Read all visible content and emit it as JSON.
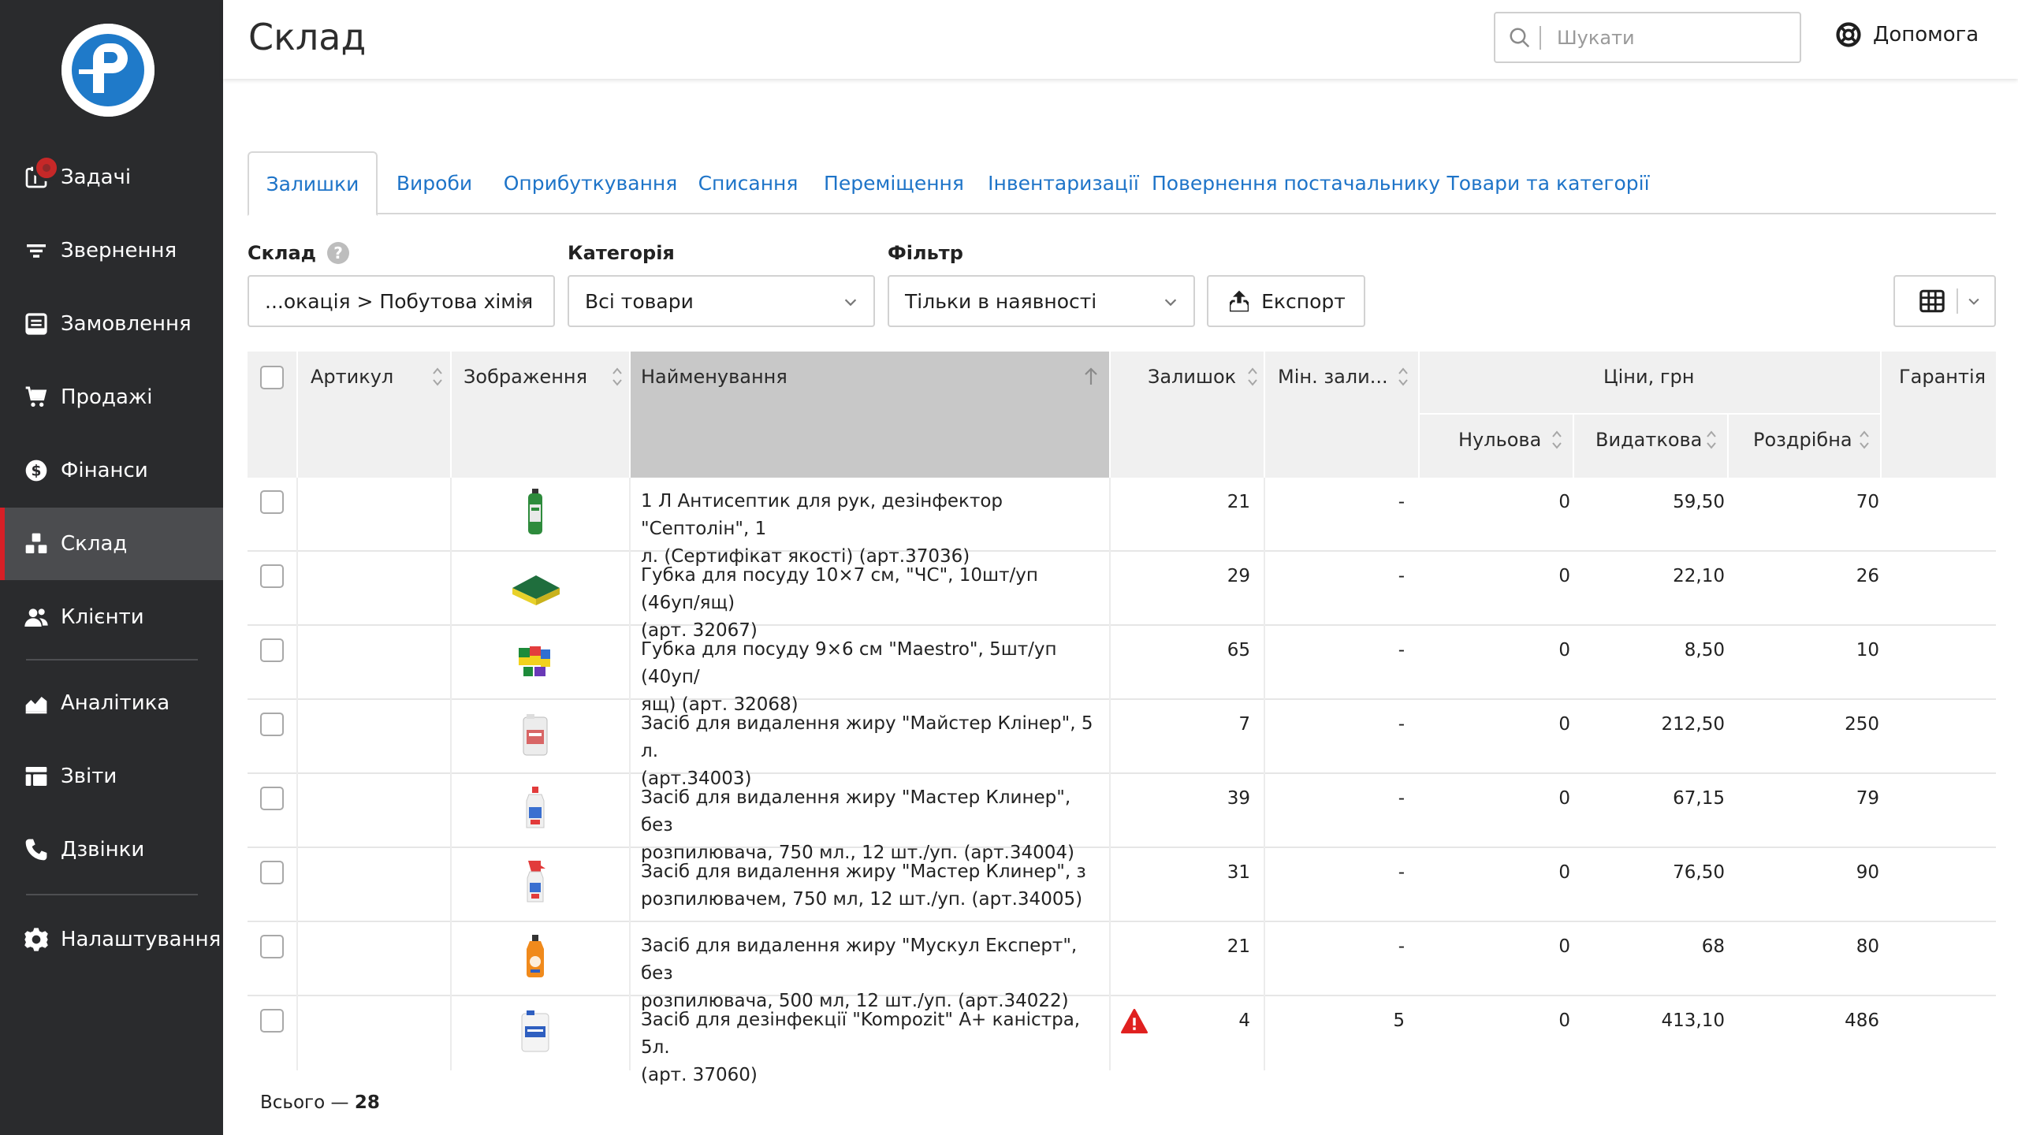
{
  "sidebar": {
    "logo_icon": "company-logo",
    "items": [
      {
        "label": "Задачі",
        "icon": "tasks-icon"
      },
      {
        "label": "Звернення",
        "icon": "filter-icon"
      },
      {
        "label": "Замовлення",
        "icon": "orders-icon"
      },
      {
        "label": "Продажі",
        "icon": "cart-icon"
      },
      {
        "label": "Фінанси",
        "icon": "dollar-icon"
      },
      {
        "label": "Склад",
        "icon": "warehouse-icon",
        "active": true
      },
      {
        "label": "Клієнти",
        "icon": "clients-icon"
      },
      {
        "label": "Аналітика",
        "icon": "analytics-icon"
      },
      {
        "label": "Звіти",
        "icon": "reports-icon"
      },
      {
        "label": "Дзвінки",
        "icon": "phone-icon"
      },
      {
        "label": "Налаштування",
        "icon": "gear-icon"
      }
    ],
    "accent_color": "#d71f26",
    "badge_color": "#c62828"
  },
  "header": {
    "title": "Склад",
    "search_placeholder": "Шукати",
    "help_label": "Допомога"
  },
  "tabs": [
    {
      "label": "Залишки",
      "active": true
    },
    {
      "label": "Вироби"
    },
    {
      "label": "Оприбуткування"
    },
    {
      "label": "Списання"
    },
    {
      "label": "Переміщення"
    },
    {
      "label": "Інвентаризації"
    },
    {
      "label": "Повернення постачальнику"
    },
    {
      "label": "Товари та категорії"
    }
  ],
  "filters": {
    "warehouse_label": "Склад",
    "warehouse_value": "...окація > Побутова хімія",
    "category_label": "Категорія",
    "category_value": "Всі товари",
    "filter_label": "Фільтр",
    "filter_value": "Тільки в наявності",
    "export_label": "Експорт"
  },
  "table": {
    "headers": {
      "article": "Артикул",
      "image": "Зображення",
      "name": "Найменування",
      "stock": "Залишок",
      "min_stock": "Мін. зали...",
      "prices_group": "Ціни, грн",
      "price_zero": "Нульова",
      "price_out": "Видаткова",
      "price_retail": "Роздрібна",
      "warranty": "Гарантія"
    },
    "rows": [
      {
        "name_line1": "1 Л Антисептик для рук, дезінфектор \"Септолін\", 1",
        "name_line2": "л. (Сертифікат якості) (арт.37036)",
        "stock": "21",
        "min": "-",
        "zero": "0",
        "out": "59,50",
        "retail": "70",
        "warn": false,
        "image": "green-bottle"
      },
      {
        "name_line1": "Губка для посуду 10×7 см, \"ЧС\", 10шт/уп (46уп/ящ)",
        "name_line2": "(арт. 32067)",
        "stock": "29",
        "min": "-",
        "zero": "0",
        "out": "22,10",
        "retail": "26",
        "warn": false,
        "image": "sponge"
      },
      {
        "name_line1": "Губка для посуду 9×6 см \"Maestro\", 5шт/уп (40уп/",
        "name_line2": "ящ) (арт. 32068)",
        "stock": "65",
        "min": "-",
        "zero": "0",
        "out": "8,50",
        "retail": "10",
        "warn": false,
        "image": "sponge-pack"
      },
      {
        "name_line1": "Засіб для видалення жиру \"Майстер Клінер\", 5 л.",
        "name_line2": "(арт.34003)",
        "stock": "7",
        "min": "-",
        "zero": "0",
        "out": "212,50",
        "retail": "250",
        "warn": false,
        "image": "canister"
      },
      {
        "name_line1": "Засіб для видалення жиру \"Мастер Клинер\", без",
        "name_line2": "розпилювача, 750 мл., 12 шт./уп. (арт.34004)",
        "stock": "39",
        "min": "-",
        "zero": "0",
        "out": "67,15",
        "retail": "79",
        "warn": false,
        "image": "bottle"
      },
      {
        "name_line1": "Засіб для видалення жиру \"Мастер Клинер\", з",
        "name_line2": "розпилювачем, 750 мл, 12 шт./уп. (арт.34005)",
        "stock": "31",
        "min": "-",
        "zero": "0",
        "out": "76,50",
        "retail": "90",
        "warn": false,
        "image": "spray-bottle"
      },
      {
        "name_line1": "Засіб для видалення жиру \"Мускул Експерт\", без",
        "name_line2": "розпилювача, 500 мл, 12 шт./уп. (арт.34022)",
        "stock": "21",
        "min": "-",
        "zero": "0",
        "out": "68",
        "retail": "80",
        "warn": false,
        "image": "orange-bottle"
      },
      {
        "name_line1": "Засіб для дезінфекції \"Kompozit\" А+ каністра, 5л.",
        "name_line2": "(арт. 37060)",
        "stock": "4",
        "min": "5",
        "zero": "0",
        "out": "413,10",
        "retail": "486",
        "warn": true,
        "image": "white-canister"
      }
    ]
  },
  "footer": {
    "total_label": "Всього —",
    "total_value": "28"
  },
  "colors": {
    "link": "#1e74c8",
    "sidebar_bg": "#2a2b2d",
    "warning": "#e0201f"
  }
}
